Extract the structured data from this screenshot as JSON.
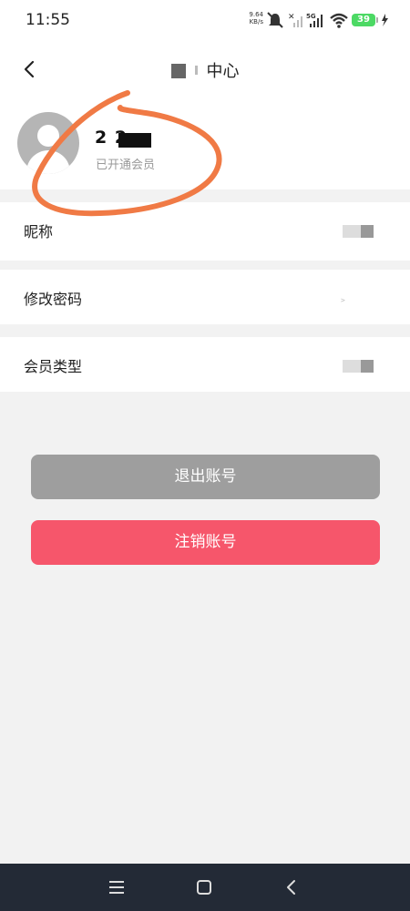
{
  "status_bar": {
    "time": "11:55",
    "net_speed_value": "9.64",
    "net_speed_unit": "KB/s",
    "network_type": "5G",
    "battery_level": "39"
  },
  "header": {
    "title": "中心"
  },
  "profile": {
    "username": "2 2",
    "member_status": "已开通会员"
  },
  "settings": {
    "items": [
      {
        "label": "昵称"
      },
      {
        "label": "修改密码",
        "hint": "﹥"
      },
      {
        "label": "会员类型"
      }
    ]
  },
  "actions": {
    "logout_label": "退出账号",
    "delete_account_label": "注销账号"
  },
  "colors": {
    "logout_button": "#9e9e9e",
    "delete_button": "#f6566b",
    "annotation_stroke": "#f07a45",
    "nav_bar": "#232a36"
  }
}
